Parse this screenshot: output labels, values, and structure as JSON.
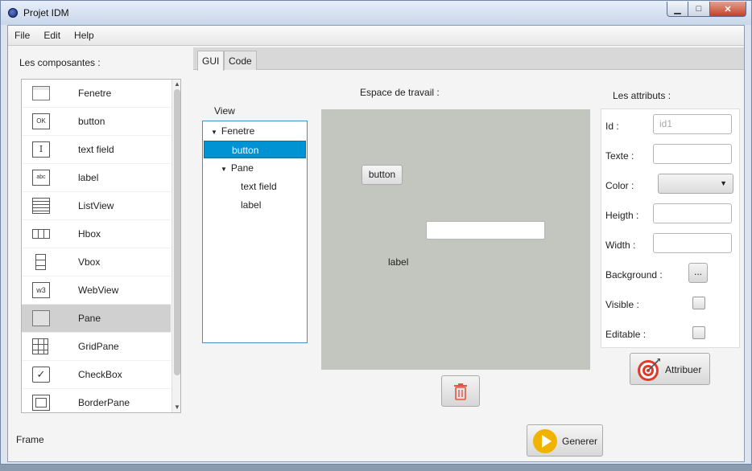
{
  "window": {
    "title": "Projet IDM"
  },
  "menu": [
    "File",
    "Edit",
    "Help"
  ],
  "left_panel": {
    "title": "Les composantes :",
    "items": [
      {
        "label": "Fenetre",
        "icon": "window-icon"
      },
      {
        "label": "button",
        "icon": "ok-button-icon",
        "glyph": "OK"
      },
      {
        "label": "text field",
        "icon": "text-field-icon",
        "glyph": "I"
      },
      {
        "label": "label",
        "icon": "label-icon",
        "glyph": "abc"
      },
      {
        "label": "ListView",
        "icon": "listview-icon"
      },
      {
        "label": "Hbox",
        "icon": "hbox-icon"
      },
      {
        "label": "Vbox",
        "icon": "vbox-icon"
      },
      {
        "label": "WebView",
        "icon": "webview-icon",
        "glyph": "w3"
      },
      {
        "label": "Pane",
        "icon": "pane-icon"
      },
      {
        "label": "GridPane",
        "icon": "gridpane-icon"
      },
      {
        "label": "CheckBox",
        "icon": "checkbox-icon",
        "glyph": "✓"
      },
      {
        "label": "BorderPane",
        "icon": "borderpane-icon"
      }
    ],
    "selected": "Pane"
  },
  "status": {
    "frame_label": "Frame"
  },
  "tabs": [
    {
      "label": "GUI",
      "active": true
    },
    {
      "label": "Code",
      "active": false
    }
  ],
  "view": {
    "title": "View",
    "tree": [
      {
        "label": "Fenetre",
        "expanded": true,
        "level": 0
      },
      {
        "label": "button",
        "level": 1,
        "selected": true
      },
      {
        "label": "Pane",
        "expanded": true,
        "level": 1
      },
      {
        "label": "text field",
        "level": 2
      },
      {
        "label": "label",
        "level": 2
      }
    ]
  },
  "workspace": {
    "title": "Espace de travail :",
    "background": "#c3c5bf",
    "button_label": "button",
    "label_text": "label"
  },
  "attributes": {
    "title": "Les attributs :",
    "id_label": "Id :",
    "id_placeholder": "id1",
    "texte_label": "Texte :",
    "color_label": "Color :",
    "heigth_label": "Heigth :",
    "width_label": "Width :",
    "background_label": "Background :",
    "background_button": "...",
    "visible_label": "Visible :",
    "editable_label": "Editable :",
    "visible_checked": false,
    "editable_checked": false
  },
  "actions": {
    "attribuer_label": "Attribuer",
    "generer_label": "Generer",
    "accent": "#0093d4",
    "play_color": "#f0b400",
    "target_color": "#e03a2a"
  }
}
